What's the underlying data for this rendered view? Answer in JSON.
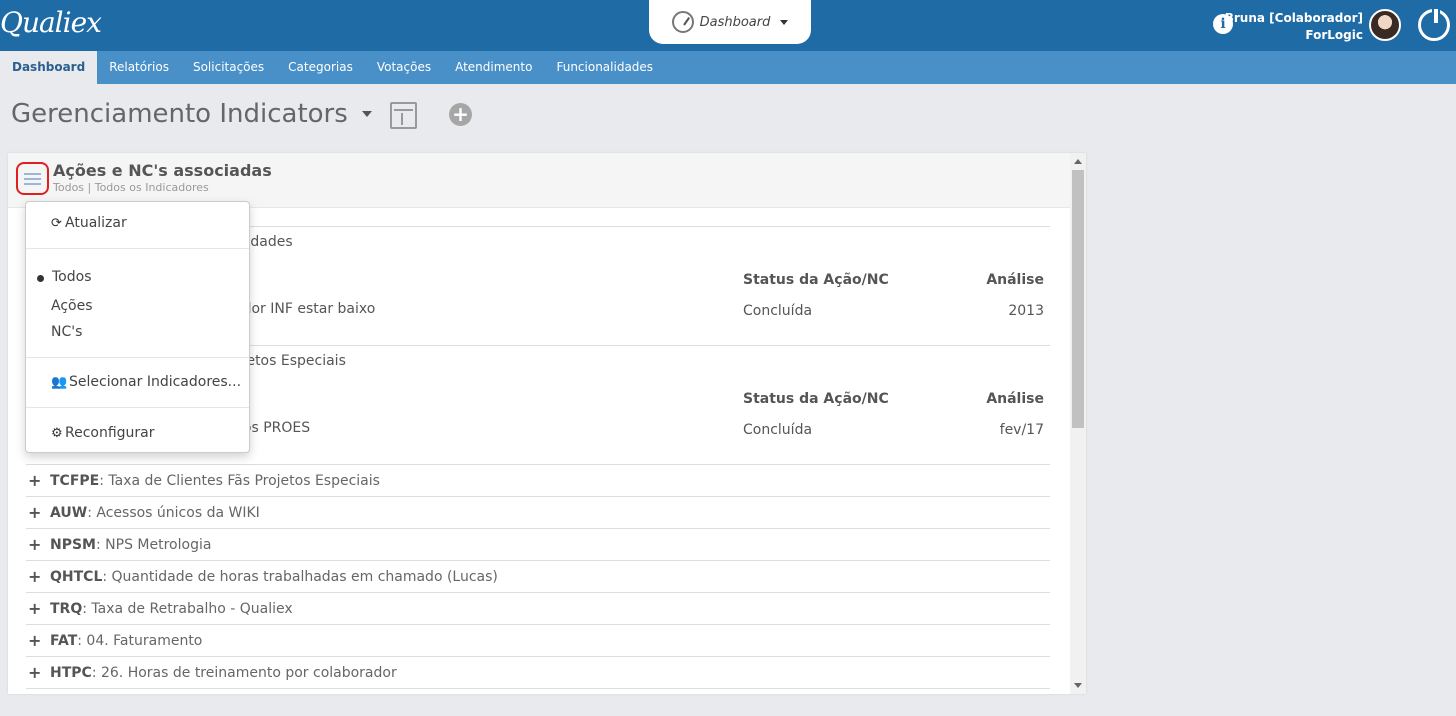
{
  "header": {
    "logo": "Qualiex",
    "dashboard_tab": "Dashboard",
    "user_name": "Bruna [Colaborador]",
    "user_company": "ForLogic"
  },
  "nav": {
    "items": [
      "Dashboard",
      "Relatórios",
      "Solicitações",
      "Categorias",
      "Votações",
      "Atendimento",
      "Funcionalidades"
    ]
  },
  "page": {
    "title": "Gerenciamento Indicators"
  },
  "widget": {
    "title": "Ações e NC's associadas",
    "subtitle": "Todos | Todos os Indicadores",
    "sections": [
      {
        "title_partial": "alidades",
        "col_status": "Status da Ação/NC",
        "col_analise": "Análise",
        "item_text": "ador INF estar baixo",
        "status": "Concluída",
        "analise": "2013"
      },
      {
        "title_partial": "ojetos Especiais",
        "col_status": "Status da Ação/NC",
        "col_analise": "Análise",
        "item_text": "dos PROES",
        "status": "Concluída",
        "analise": "fev/17"
      }
    ],
    "rows": [
      {
        "code": "TCFPE",
        "desc": ": Taxa de Clientes Fãs Projetos Especiais"
      },
      {
        "code": "AUW",
        "desc": ": Acessos únicos da WIKI"
      },
      {
        "code": "NPSM",
        "desc": ": NPS Metrologia"
      },
      {
        "code": "QHTCL",
        "desc": ": Quantidade de horas trabalhadas em chamado (Lucas)"
      },
      {
        "code": "TRQ",
        "desc": ": Taxa de Retrabalho - Qualiex"
      },
      {
        "code": "FAT",
        "desc": ": 04. Faturamento"
      },
      {
        "code": "HTPC",
        "desc": ": 26. Horas de treinamento por colaborador"
      }
    ]
  },
  "dropdown": {
    "refresh": "Atualizar",
    "filter_all": "Todos",
    "filter_actions": "Ações",
    "filter_ncs": "NC's",
    "select_indicators": "Selecionar Indicadores...",
    "reconfigure": "Reconfigurar"
  }
}
